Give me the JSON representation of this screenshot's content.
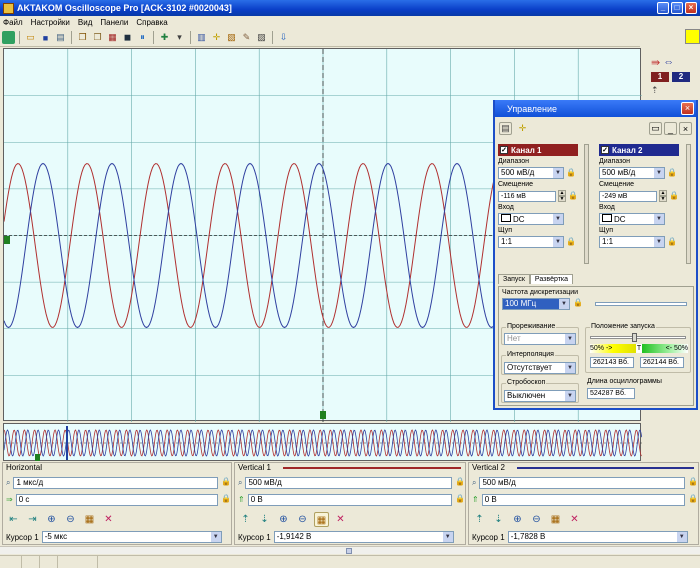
{
  "window": {
    "title": "AKTAKOM Oscilloscope Pro [ACK-3102 #0020043]",
    "title_icon": "app-icon"
  },
  "menu": {
    "items": [
      "Файл",
      "Настройки",
      "Вид",
      "Панели",
      "Справка"
    ]
  },
  "colors": {
    "ch1": "#b03030",
    "ch2": "#3040a0",
    "grid": "#66aaaa",
    "screen": "#e8fcfc",
    "accent": "#1c4ec8"
  },
  "right_panel": {
    "ch1_label": "1",
    "ch2_label": "2"
  },
  "horizontal": {
    "title": "Horizontal",
    "scale": "1 мкс/д",
    "offset": "0 с",
    "cursor_label": "Курсор 1",
    "cursor_value": "-5 мкс"
  },
  "vertical1": {
    "title": "Vertical 1",
    "scale": "500 мВ/д",
    "offset": "0 В",
    "cursor_label": "Курсор 1",
    "cursor_value": "-1,9142 В"
  },
  "vertical2": {
    "title": "Vertical 2",
    "scale": "500 мВ/д",
    "offset": "0 В",
    "cursor_label": "Курсор 1",
    "cursor_value": "-1,7828 В"
  },
  "dialog": {
    "title": "Управление",
    "ch1": {
      "name": "Канал 1",
      "range_label": "Диапазон",
      "range": "500 мВ/д",
      "offset_label": "Смещение",
      "offset": "-116 мВ",
      "input_label": "Вход",
      "input": "DC",
      "probe_label": "Щуп",
      "probe": "1:1"
    },
    "ch2": {
      "name": "Канал 2",
      "range_label": "Диапазон",
      "range": "500 мВ/д",
      "offset_label": "Смещение",
      "offset": "-249 мВ",
      "input_label": "Вход",
      "input": "DC",
      "probe_label": "Щуп",
      "probe": "1:1"
    },
    "tabs": [
      "Запуск",
      "Развёртка"
    ],
    "sample_rate_label": "Частота дискретизации",
    "sample_rate": "100 МГц",
    "interleave_label": "Прореживание",
    "interleave": "Нет",
    "trigger_pos_label": "Положение запуска",
    "pct_left": "50%",
    "pct_right": "50%",
    "arrow_left": "->",
    "arrow_right": "<-",
    "trig_marker": "T",
    "pos_left": "262143 Вб.",
    "pos_right": "262144 Вб.",
    "interp_label": "Интерполяция",
    "interp": "Отсутствует",
    "strobe_label": "Стробоскоп",
    "strobe": "Выключен",
    "length_label": "Длина осциллограммы",
    "length": "524287 Вб."
  }
}
